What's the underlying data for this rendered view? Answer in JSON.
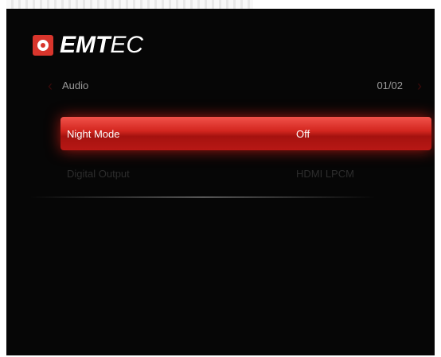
{
  "brand": {
    "wordmark_bold": "EMT",
    "wordmark_light": "EC",
    "logo_icon": "emtec-logo-icon"
  },
  "header": {
    "section_title": "Audio",
    "page_counter": "01/02",
    "prev_icon": "chevron-left-icon",
    "next_icon": "chevron-right-icon"
  },
  "menu": {
    "items": [
      {
        "label": "Night Mode",
        "value": "Off",
        "selected": true
      },
      {
        "label": "Digital Output",
        "value": "HDMI LPCM",
        "selected": false
      }
    ]
  },
  "colors": {
    "background": "#060606",
    "highlight": "#d3261f",
    "inactive_text": "#2d2d2d",
    "header_text": "#9a9a9a"
  }
}
